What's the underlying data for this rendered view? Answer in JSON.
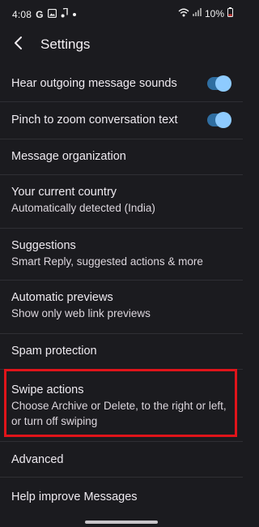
{
  "status_bar": {
    "time": "4:08",
    "g_label": "G",
    "battery": "10%",
    "icons": [
      "google-icon",
      "gallery-icon",
      "music-note-icon",
      "dot-icon",
      "wifi-icon",
      "signal-icon",
      "battery-icon"
    ]
  },
  "app_bar": {
    "title": "Settings",
    "back_icon": "back-arrow-icon"
  },
  "settings": {
    "items": [
      {
        "title": "Hear outgoing message sounds",
        "toggle": true
      },
      {
        "title": "Pinch to zoom conversation text",
        "toggle": true
      },
      {
        "title": "Message organization"
      },
      {
        "title": "Your current country",
        "subtitle": "Automatically detected (India)"
      },
      {
        "title": "Suggestions",
        "subtitle": "Smart Reply, suggested actions & more"
      },
      {
        "title": "Automatic previews",
        "subtitle": "Show only web link previews"
      },
      {
        "title": "Spam protection"
      },
      {
        "title": "Swipe actions",
        "subtitle_line1": "Choose Archive or Delete, to the right or left,",
        "subtitle_line2": "or turn off swiping"
      },
      {
        "title": "Advanced"
      },
      {
        "title": "Help improve Messages"
      }
    ]
  },
  "colors": {
    "background": "#1b1b1f",
    "toggle_track": "#2f6ea1",
    "toggle_thumb": "#8ecbff",
    "highlight": "#e0141a"
  }
}
